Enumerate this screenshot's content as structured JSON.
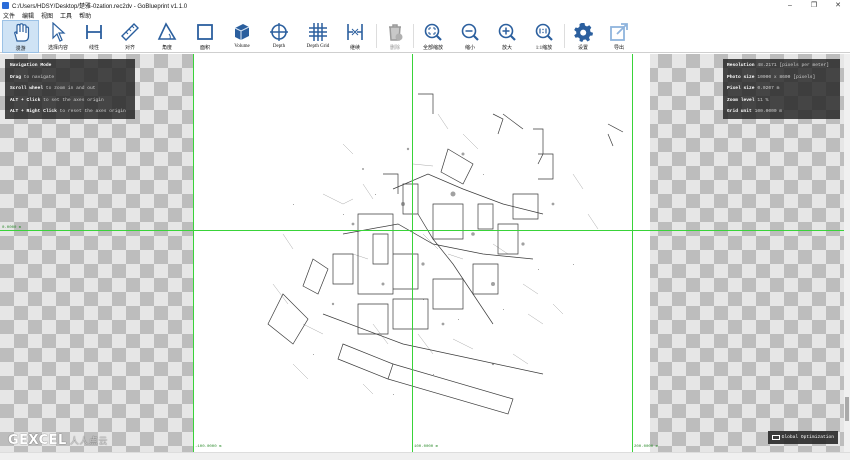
{
  "window": {
    "title": "C:/Users/HDSY/Desktop/楚雅-0zation.rec2dv - GoBlueprint v1.1.0",
    "minimize": "–",
    "maximize": "❐",
    "close": "✕"
  },
  "menu": [
    "文件",
    "编辑",
    "视图",
    "工具",
    "帮助"
  ],
  "toolbar": {
    "tools": [
      {
        "id": "tool-pan",
        "label": "漫游",
        "icon": "hand-icon",
        "active": true,
        "disabled": false
      },
      {
        "id": "tool-select",
        "label": "选择内容",
        "icon": "cursor-icon",
        "active": false,
        "disabled": false
      },
      {
        "id": "tool-line",
        "label": "线性",
        "icon": "line-measure-icon",
        "active": false,
        "disabled": false
      },
      {
        "id": "tool-align",
        "label": "对齐",
        "icon": "ruler-icon",
        "active": false,
        "disabled": false
      },
      {
        "id": "tool-angle",
        "label": "角度",
        "icon": "angle-icon",
        "active": false,
        "disabled": false
      },
      {
        "id": "tool-area",
        "label": "面积",
        "icon": "area-icon",
        "active": false,
        "disabled": false
      },
      {
        "id": "tool-volume",
        "label": "Volume",
        "icon": "cube-icon",
        "active": false,
        "disabled": false
      },
      {
        "id": "tool-depth",
        "label": "Depth",
        "icon": "crosshair-icon",
        "active": false,
        "disabled": false
      },
      {
        "id": "tool-depth-grid",
        "label": "Depth Grid",
        "icon": "grid-icon",
        "active": false,
        "disabled": false
      },
      {
        "id": "tool-continue",
        "label": "继续",
        "icon": "continue-icon",
        "active": false,
        "disabled": false
      },
      {
        "id": "tool-delete",
        "label": "删除",
        "icon": "trash-icon",
        "active": false,
        "disabled": true
      },
      {
        "id": "tool-fit",
        "label": "全部缩放",
        "icon": "zoom-fit-icon",
        "active": false,
        "disabled": false
      },
      {
        "id": "tool-zoom-out",
        "label": "缩小",
        "icon": "zoom-out-icon",
        "active": false,
        "disabled": false
      },
      {
        "id": "tool-zoom-in",
        "label": "放大",
        "icon": "zoom-in-icon",
        "active": false,
        "disabled": false
      },
      {
        "id": "tool-zoom-1to1",
        "label": "1:1缩放",
        "icon": "zoom-1to1-icon",
        "active": false,
        "disabled": false
      },
      {
        "id": "tool-settings",
        "label": "设置",
        "icon": "gear-icon",
        "active": false,
        "disabled": false
      },
      {
        "id": "tool-export",
        "label": "导出",
        "icon": "export-icon",
        "active": false,
        "disabled": false
      }
    ]
  },
  "nav_help": {
    "title": "Navigation Mode",
    "lines": [
      {
        "key": "Drag",
        "text": "to navigate"
      },
      {
        "key": "Scroll wheel",
        "text": "to zoom in and out"
      },
      {
        "key": "ALT + Click",
        "text": "to set the axes origin"
      },
      {
        "key": "ALT + Right Click",
        "text": "to reset the axes origin"
      }
    ]
  },
  "info": [
    {
      "key": "Resolution",
      "value": "48.2171 [pixels per meter]"
    },
    {
      "key": "Photo size",
      "value": "10000 x 8600 [pixels]"
    },
    {
      "key": "Pixel size",
      "value": "0.0207 m"
    },
    {
      "key": "Zoom level",
      "value": "11 %"
    },
    {
      "key": "Grid unit",
      "value": "100.0000 m"
    }
  ],
  "axes": {
    "y_origin": "0.0000 m",
    "x_left": "-100.0000 m",
    "x_mid": "100.0000 m",
    "x_right": "200.0000 m"
  },
  "optimization_badge": "Global Optimization",
  "watermark": {
    "main": "GEXCEL",
    "sub": "人人点云"
  },
  "colors": {
    "guide": "#39d339",
    "active_tool": "#cfe3f5",
    "icon": "#2b5f9e"
  }
}
